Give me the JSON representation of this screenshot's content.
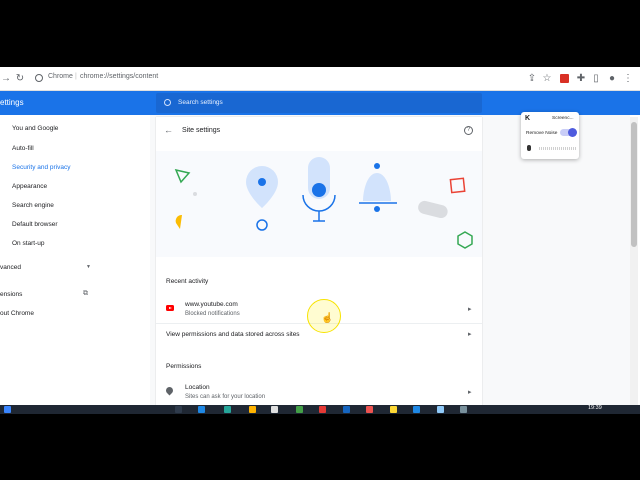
{
  "browser": {
    "site_chip": "Chrome",
    "separator": "|",
    "url": "chrome://settings/content",
    "nav_icons": [
      "arrow-right-icon",
      "reload-icon"
    ],
    "toolbar_icons": [
      "share-icon",
      "bookmark-star-icon",
      "red-extension-icon",
      "puzzle-icon",
      "side-panel-icon",
      "profile-icon",
      "menu-icon"
    ]
  },
  "header": {
    "title": "ettings",
    "search_placeholder": "Search settings"
  },
  "sidebar": {
    "items": [
      {
        "label": "You and Google",
        "active": false
      },
      {
        "label": "Auto-fill",
        "active": false
      },
      {
        "label": "Security and privacy",
        "active": true
      },
      {
        "label": "Appearance",
        "active": false
      },
      {
        "label": "Search engine",
        "active": false
      },
      {
        "label": "Default browser",
        "active": false
      },
      {
        "label": "On start-up",
        "active": false
      }
    ],
    "advanced": "vanced",
    "extensions": "ensions",
    "about": "out Chrome"
  },
  "page": {
    "title": "Site settings",
    "recent_heading": "Recent activity",
    "recent_items": [
      {
        "title": "www.youtube.com",
        "subtitle": "Blocked notifications"
      }
    ],
    "view_permissions": "View permissions and data stored across sites",
    "permissions_heading": "Permissions",
    "permissions": [
      {
        "title": "Location",
        "subtitle": "Sites can ask for your location"
      }
    ]
  },
  "popup": {
    "logo": "K",
    "name": "Screenc...",
    "remove_noise_label": "Remove Noise"
  },
  "taskbar": {
    "time": "19:39"
  },
  "colors": {
    "accent": "#1a73e8",
    "header": "#1a73e8",
    "youtube": "#ff0000",
    "illustration_blue": "#1a73e8",
    "illustration_light": "#d2e3fc",
    "cursor_highlight": "#f7e300"
  }
}
